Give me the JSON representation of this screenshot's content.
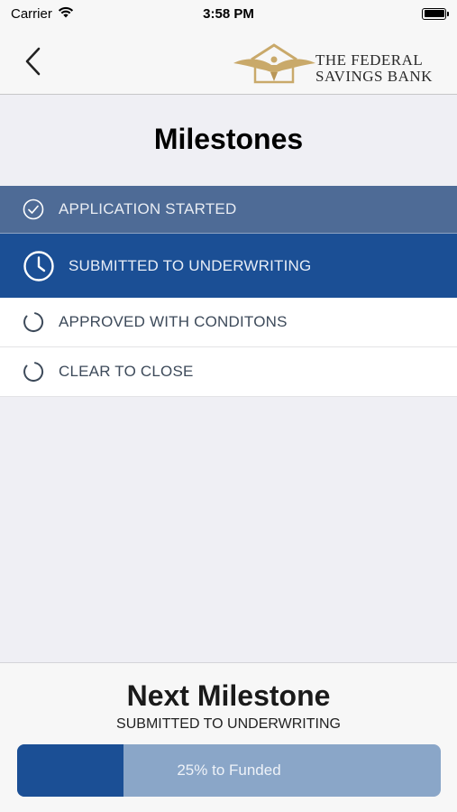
{
  "status_bar": {
    "carrier": "Carrier",
    "time": "3:58 PM"
  },
  "nav": {
    "logo_line1": "THE FEDERAL",
    "logo_line2": "SAVINGS BANK"
  },
  "page_title": "Milestones",
  "milestones": [
    {
      "label": "APPLICATION STARTED",
      "state": "completed",
      "icon": "check-circle-icon"
    },
    {
      "label": "SUBMITTED TO UNDERWRITING",
      "state": "current",
      "icon": "clock-icon"
    },
    {
      "label": "APPROVED WITH CONDITONS",
      "state": "pending",
      "icon": "pending-circle-icon"
    },
    {
      "label": "CLEAR TO CLOSE",
      "state": "pending",
      "icon": "pending-circle-icon"
    }
  ],
  "next_milestone": {
    "title": "Next Milestone",
    "name": "SUBMITTED TO UNDERWRITING"
  },
  "progress": {
    "percent": 25,
    "label": "25% to Funded"
  },
  "colors": {
    "completed_bg": "#4e6b96",
    "current_bg": "#1b4f95",
    "pending_bg": "#ffffff",
    "progress_track": "#8aa6c8",
    "progress_fill": "#1b4f95",
    "logo_gold": "#c9a96a"
  }
}
